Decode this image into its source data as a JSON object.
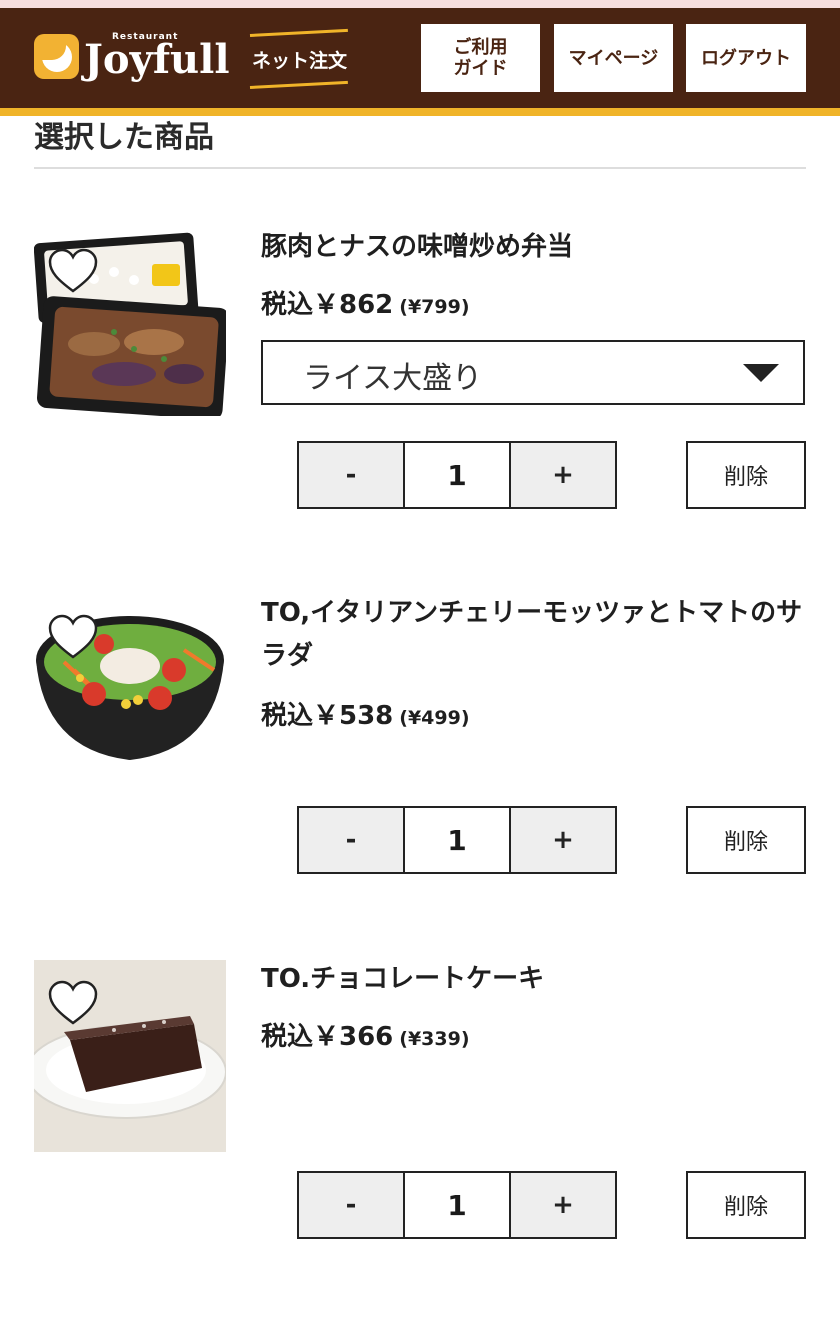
{
  "colors": {
    "header_bg": "#4a2412",
    "accent": "#f0b429",
    "button_text": "#4a2412"
  },
  "header": {
    "logo_small": "Restaurant",
    "logo_text": "Joyfull",
    "net_order": "ネット注文",
    "guide_line1": "ご利用",
    "guide_line2": "ガイド",
    "mypage": "マイページ",
    "logout": "ログアウト"
  },
  "section_title": "選択した商品",
  "items": [
    {
      "name": "豚肉とナスの味噌炒め弁当",
      "price": "税込￥862",
      "price_ex": "(¥799)",
      "option": "ライス大盛り",
      "qty_minus": "-",
      "qty": "1",
      "qty_plus": "+",
      "delete": "削除",
      "image": "bento-image"
    },
    {
      "name": "TO,イタリアンチェリーモッツァとトマトのサラダ",
      "price": "税込￥538",
      "price_ex": "(¥499)",
      "qty_minus": "-",
      "qty": "1",
      "qty_plus": "+",
      "delete": "削除",
      "image": "salad-image"
    },
    {
      "name": "TO.チョコレートケーキ",
      "price": "税込￥366",
      "price_ex": "(¥339)",
      "qty_minus": "-",
      "qty": "1",
      "qty_plus": "+",
      "delete": "削除",
      "image": "chocolate-cake-image"
    }
  ]
}
